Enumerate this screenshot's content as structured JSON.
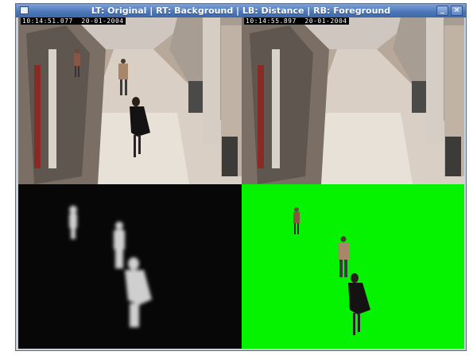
{
  "window": {
    "title": "LT: Original | RT: Background | LB: Distance | RB: Foreground",
    "minimize_label": "_",
    "close_label": "×"
  },
  "panes": {
    "lt": {
      "timestamp": "10:14:51.077  20-01-2004"
    },
    "rt": {
      "timestamp": "10:14:55.897  20-01-2004"
    }
  },
  "colors": {
    "foreground_bg": "#05f200",
    "distance_bg": "#060606",
    "titlebar": "#4a76b8"
  },
  "icons": {
    "app": "window-icon",
    "minimize": "minimize-icon",
    "close": "close-icon"
  }
}
